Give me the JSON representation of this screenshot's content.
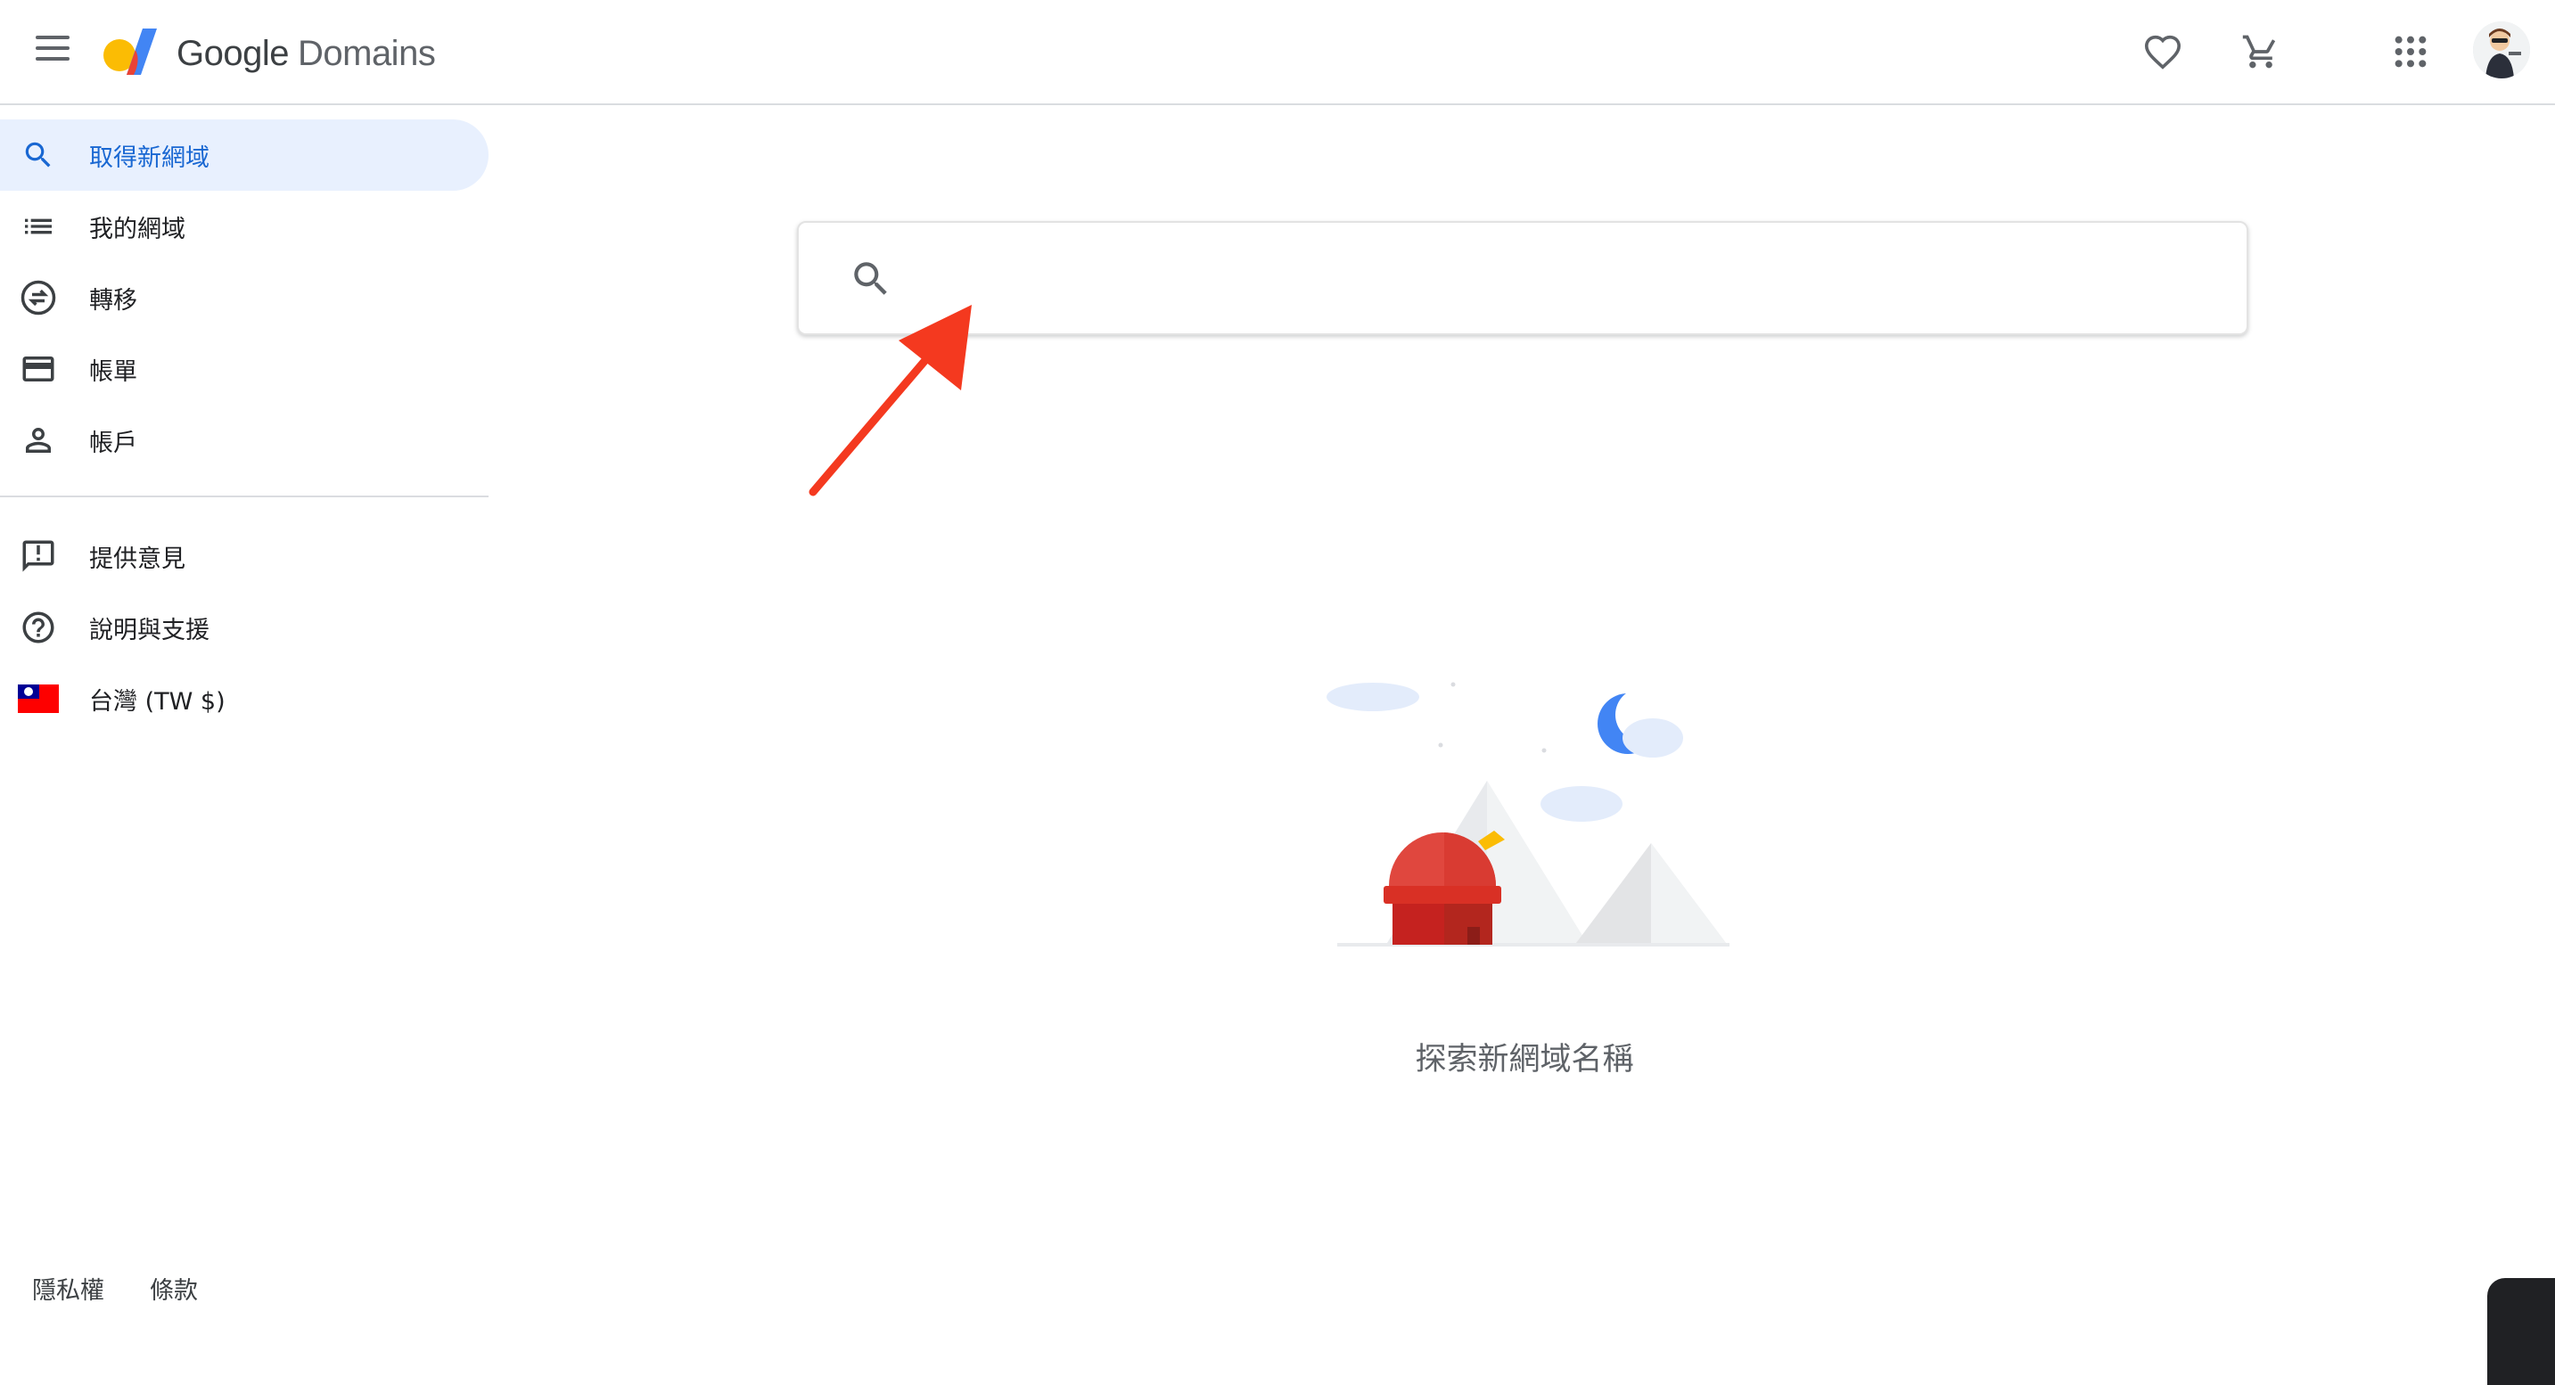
{
  "header": {
    "brand_google": "Google",
    "brand_domains": "Domains",
    "icons": [
      "menu-icon",
      "google-domains-logo",
      "heart-icon",
      "cart-icon",
      "apps-grid-icon",
      "user-avatar"
    ]
  },
  "sidebar": {
    "items": [
      {
        "label": "取得新網域",
        "icon": "search-icon",
        "active": true
      },
      {
        "label": "我的網域",
        "icon": "list-icon"
      },
      {
        "label": "轉移",
        "icon": "transfer-icon"
      },
      {
        "label": "帳單",
        "icon": "credit-card-icon"
      },
      {
        "label": "帳戶",
        "icon": "person-icon"
      },
      {
        "label": "提供意見",
        "icon": "feedback-icon"
      },
      {
        "label": "說明與支援",
        "icon": "help-icon"
      },
      {
        "label": "台灣 (TW $)",
        "icon": "taiwan-flag-icon"
      }
    ],
    "footer": {
      "privacy": "隱私權",
      "terms": "條款"
    }
  },
  "main": {
    "search": {
      "value": "",
      "placeholder": ""
    },
    "caption": "探索新網域名稱"
  },
  "colors": {
    "accent": "#1967d2",
    "active_bg": "#e8f0fe",
    "annotation_arrow": "#f4391f"
  }
}
